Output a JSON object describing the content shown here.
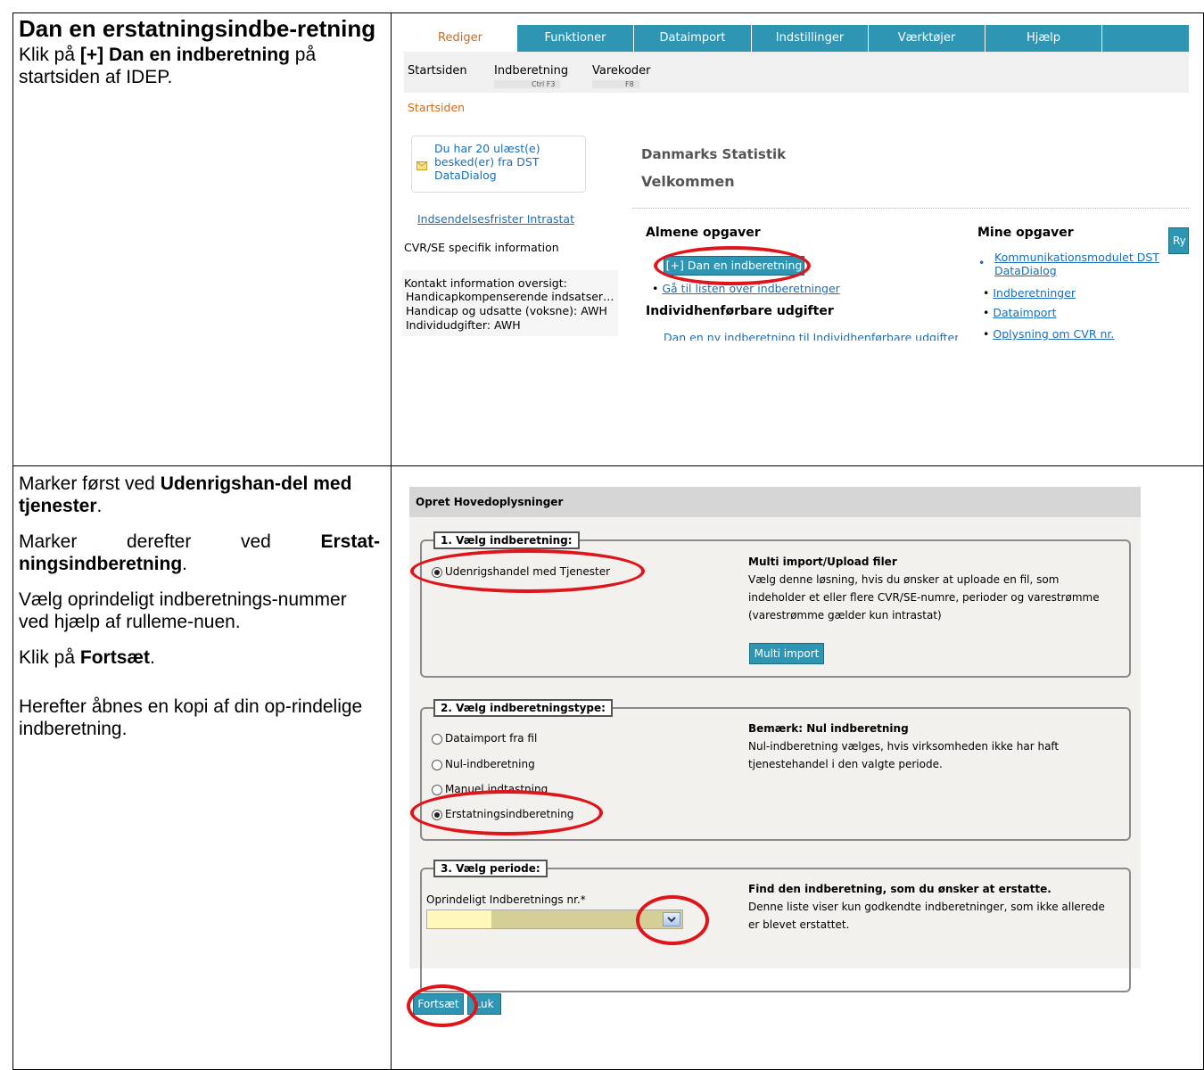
{
  "row1": {
    "title": "Dan en erstatningsindbe-retning",
    "instruction_prefix": "Klik på ",
    "instruction_bold": "[+] Dan en indberetning",
    "instruction_suffix": " på startsiden af IDEP."
  },
  "row2": {
    "p1_prefix": "Marker først ved ",
    "p1_bold": "Udenrigshan-del med tjenester",
    "p1_suffix": ".",
    "p2_prefix": "Marker derefter ved ",
    "p2_bold": "Erstat-ningsindberetning",
    "p2_suffix": ".",
    "p3": "Vælg oprindeligt indberetnings-nummer ved hjælp af rulleme-nuen.",
    "p4_prefix": "Klik på ",
    "p4_bold": "Fortsæt",
    "p4_suffix": ".",
    "p5": "Herefter åbnes en kopi af din op-rindelige indberetning."
  },
  "idep": {
    "menu": [
      "Rediger",
      "Funktioner",
      "Dataimport",
      "Indstillinger",
      "Værktøjer",
      "Hjælp"
    ],
    "submenu": [
      {
        "label": "Startsiden",
        "key": ""
      },
      {
        "label": "Indberetning",
        "key": "Ctrl F3"
      },
      {
        "label": "Varekoder",
        "key": "F8"
      }
    ],
    "breadcrumb": "Startsiden",
    "message_box": "Du har 20 ulæst(e) besked(er) fra DST DataDialog",
    "deadline_link": "Indsendelsesfrister Intrastat",
    "cvr_info": "CVR/SE specifik information",
    "contact_title": "Kontakt information oversigt:",
    "contact_lines": [
      "Handicapkompenserende indsatser…",
      "Handicap og udsatte (voksne): AWH",
      "Individudgifter: AWH"
    ],
    "org": "Danmarks Statistik",
    "welcome": "Velkommen",
    "common_tasks": "Almene opgaver",
    "create_button": "[+] Dan en indberetning",
    "list_link": "Gå til listen over indberetninger",
    "individual_heading": "Individhenførbare udgifter",
    "individual_line": "Dan en ny indberetning til Individhenførbare udgifter",
    "my_tasks": "Mine opgaver",
    "my_tasks_links": [
      "Kommunikationsmodulet DST DataDialog",
      "Indberetninger",
      "Dataimport",
      "Oplysning om CVR nr."
    ],
    "side_button": "Ry"
  },
  "form": {
    "title": "Opret Hovedoplysninger",
    "step1": {
      "legend": "1. Vælg indberetning:",
      "option": "Udenrigshandel med Tjenester",
      "info_title": "Multi import/Upload filer",
      "info_text": "Vælg denne løsning, hvis du ønsker at uploade en fil, som indeholder et eller flere CVR/SE-numre, perioder og varestrømme (varestrømme gælder kun intrastat)",
      "button": "Multi import"
    },
    "step2": {
      "legend": "2. Vælg indberetningstype:",
      "options": [
        "Dataimport fra fil",
        "Nul-indberetning",
        "Manuel indtastning",
        "Erstatningsindberetning"
      ],
      "selected": "Erstatningsindberetning",
      "info_title": "Bemærk: Nul indberetning",
      "info_text": "Nul-indberetning vælges, hvis virksomheden ikke har haft tjenestehandel i den valgte periode."
    },
    "step3": {
      "legend": "3. Vælg periode:",
      "field_label": "Oprindeligt Indberetnings nr.*",
      "select_value": "",
      "info_title": "Find den indberetning, som du ønsker at erstatte.",
      "info_text": "Denne liste viser kun godkendte indberetninger, som ikke allerede er blevet erstattet."
    },
    "continue": "Fortsæt",
    "close": "Luk"
  },
  "colors": {
    "accent": "#2e95b3",
    "highlight_ring": "#e0141b",
    "active_tab_text": "#d06a17",
    "link": "#1a6eb5"
  }
}
